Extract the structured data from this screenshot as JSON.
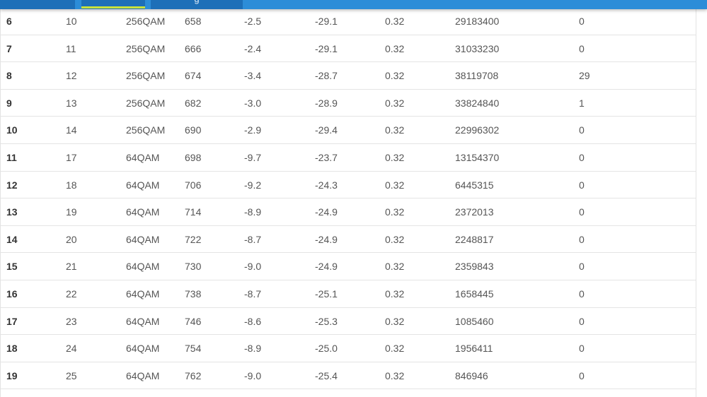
{
  "tabs": [
    {
      "label": ""
    },
    {
      "label": ""
    },
    {
      "label": "g"
    }
  ],
  "table": {
    "rows": [
      [
        "6",
        "10",
        "256QAM",
        "658",
        "-2.5",
        "-29.1",
        "0.32",
        "29183400",
        "0"
      ],
      [
        "7",
        "11",
        "256QAM",
        "666",
        "-2.4",
        "-29.1",
        "0.32",
        "31033230",
        "0"
      ],
      [
        "8",
        "12",
        "256QAM",
        "674",
        "-3.4",
        "-28.7",
        "0.32",
        "38119708",
        "29"
      ],
      [
        "9",
        "13",
        "256QAM",
        "682",
        "-3.0",
        "-28.9",
        "0.32",
        "33824840",
        "1"
      ],
      [
        "10",
        "14",
        "256QAM",
        "690",
        "-2.9",
        "-29.4",
        "0.32",
        "22996302",
        "0"
      ],
      [
        "11",
        "17",
        "64QAM",
        "698",
        "-9.7",
        "-23.7",
        "0.32",
        "13154370",
        "0"
      ],
      [
        "12",
        "18",
        "64QAM",
        "706",
        "-9.2",
        "-24.3",
        "0.32",
        "6445315",
        "0"
      ],
      [
        "13",
        "19",
        "64QAM",
        "714",
        "-8.9",
        "-24.9",
        "0.32",
        "2372013",
        "0"
      ],
      [
        "14",
        "20",
        "64QAM",
        "722",
        "-8.7",
        "-24.9",
        "0.32",
        "2248817",
        "0"
      ],
      [
        "15",
        "21",
        "64QAM",
        "730",
        "-9.0",
        "-24.9",
        "0.32",
        "2359843",
        "0"
      ],
      [
        "16",
        "22",
        "64QAM",
        "738",
        "-8.7",
        "-25.1",
        "0.32",
        "1658445",
        "0"
      ],
      [
        "17",
        "23",
        "64QAM",
        "746",
        "-8.6",
        "-25.3",
        "0.32",
        "1085460",
        "0"
      ],
      [
        "18",
        "24",
        "64QAM",
        "754",
        "-8.9",
        "-25.0",
        "0.32",
        "1956411",
        "0"
      ],
      [
        "19",
        "25",
        "64QAM",
        "762",
        "-9.0",
        "-25.4",
        "0.32",
        "846946",
        "0"
      ]
    ]
  }
}
